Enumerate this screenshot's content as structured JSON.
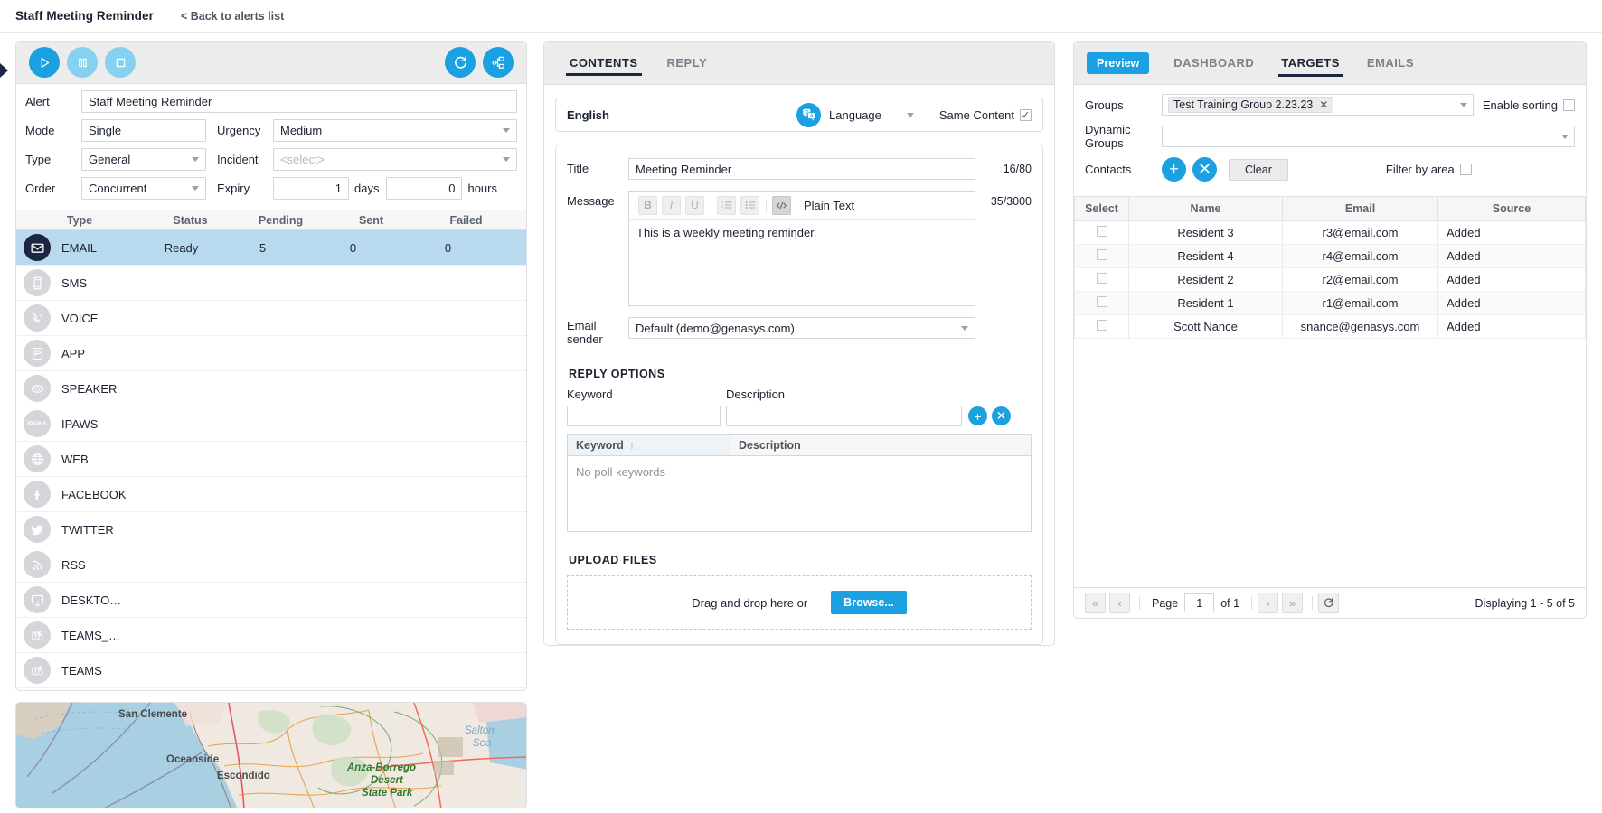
{
  "header": {
    "title": "Staff Meeting Reminder",
    "back_link": "< Back to alerts list"
  },
  "alert_panel": {
    "toolbar": {
      "play_icon": "play-icon",
      "pause_icon": "pause-icon",
      "stop_icon": "stop-icon",
      "refresh_icon": "refresh-icon",
      "workflow_icon": "workflow-icon"
    },
    "fields": {
      "alert_label": "Alert",
      "alert_value": "Staff Meeting Reminder",
      "mode_label": "Mode",
      "mode_value": "Single",
      "urgency_label": "Urgency",
      "urgency_value": "Medium",
      "type_label": "Type",
      "type_value": "General",
      "incident_label": "Incident",
      "incident_placeholder": "<select>",
      "order_label": "Order",
      "order_value": "Concurrent",
      "expiry_label": "Expiry",
      "expiry_days": "1",
      "days_unit": "days",
      "expiry_hours": "0",
      "hours_unit": "hours"
    },
    "channel_headers": [
      "Type",
      "Status",
      "Pending",
      "Sent",
      "Failed"
    ],
    "channels": [
      {
        "icon": "email-icon",
        "name": "EMAIL",
        "status": "Ready",
        "pending": "5",
        "sent": "0",
        "failed": "0",
        "selected": true
      },
      {
        "icon": "sms-icon",
        "name": "SMS",
        "status": "",
        "pending": "",
        "sent": "",
        "failed": "",
        "selected": false
      },
      {
        "icon": "voice-icon",
        "name": "VOICE",
        "status": "",
        "pending": "",
        "sent": "",
        "failed": "",
        "selected": false
      },
      {
        "icon": "app-icon",
        "name": "APP",
        "status": "",
        "pending": "",
        "sent": "",
        "failed": "",
        "selected": false
      },
      {
        "icon": "speaker-icon",
        "name": "SPEAKER",
        "status": "",
        "pending": "",
        "sent": "",
        "failed": "",
        "selected": false
      },
      {
        "icon": "ipaws-icon",
        "name": "IPAWS",
        "status": "",
        "pending": "",
        "sent": "",
        "failed": "",
        "selected": false
      },
      {
        "icon": "web-icon",
        "name": "WEB",
        "status": "",
        "pending": "",
        "sent": "",
        "failed": "",
        "selected": false
      },
      {
        "icon": "facebook-icon",
        "name": "FACEBOOK",
        "status": "",
        "pending": "",
        "sent": "",
        "failed": "",
        "selected": false
      },
      {
        "icon": "twitter-icon",
        "name": "TWITTER",
        "status": "",
        "pending": "",
        "sent": "",
        "failed": "",
        "selected": false
      },
      {
        "icon": "rss-icon",
        "name": "RSS",
        "status": "",
        "pending": "",
        "sent": "",
        "failed": "",
        "selected": false
      },
      {
        "icon": "desktop-icon",
        "name": "DESKTO…",
        "status": "",
        "pending": "",
        "sent": "",
        "failed": "",
        "selected": false
      },
      {
        "icon": "teams-icon",
        "name": "TEAMS_…",
        "status": "",
        "pending": "",
        "sent": "",
        "failed": "",
        "selected": false
      },
      {
        "icon": "teams-icon",
        "name": "TEAMS",
        "status": "",
        "pending": "",
        "sent": "",
        "failed": "",
        "selected": false
      }
    ]
  },
  "map": {
    "labels": [
      {
        "text": "San Clemente",
        "style": "dark"
      },
      {
        "text": "Oceanside",
        "style": "dark"
      },
      {
        "text": "Escondido",
        "style": "dark"
      },
      {
        "text": "Anza-Borrego",
        "style": "green"
      },
      {
        "text": "Desert",
        "style": "green"
      },
      {
        "text": "State Park",
        "style": "green"
      },
      {
        "text": "Salton",
        "style": "blue"
      },
      {
        "text": "Sea",
        "style": "blue"
      }
    ]
  },
  "contents": {
    "tabs": [
      {
        "label": "CONTENTS",
        "active": true
      },
      {
        "label": "REPLY",
        "active": false
      }
    ],
    "language": {
      "name": "English",
      "icon": "translate-icon",
      "button_label": "Language",
      "same_content_label": "Same Content",
      "same_content_checked": true
    },
    "title_label": "Title",
    "title_value": "Meeting Reminder",
    "title_counter": "16/80",
    "message_label": "Message",
    "message_value": "This is a weekly meeting reminder.",
    "message_counter": "35/3000",
    "editor_buttons": [
      "B",
      "I",
      "U",
      "ordered-list-icon",
      "unordered-list-icon",
      "source-code-icon"
    ],
    "plain_text_label": "Plain Text",
    "sender_label": "Email sender",
    "sender_value": "Default (demo@genasys.com)",
    "reply_options": {
      "section_title": "REPLY OPTIONS",
      "keyword_label": "Keyword",
      "description_label": "Description",
      "keyword_value": "",
      "description_value": "",
      "add_icon": "plus-icon",
      "remove_icon": "close-icon",
      "grid_headers": [
        "Keyword",
        "Description"
      ],
      "sort_indicator": "↑",
      "empty_text": "No poll keywords"
    },
    "upload": {
      "section_title": "UPLOAD FILES",
      "drop_text": "Drag and drop here or",
      "browse_label": "Browse..."
    }
  },
  "targets": {
    "tabs": [
      {
        "label": "Preview",
        "active": false,
        "pill": true
      },
      {
        "label": "DASHBOARD",
        "active": false,
        "pill": false
      },
      {
        "label": "TARGETS",
        "active": true,
        "pill": false
      },
      {
        "label": "EMAILS",
        "active": false,
        "pill": false
      }
    ],
    "groups_label": "Groups",
    "groups_chip": "Test Training Group 2.23.23",
    "chip_close_icon": "close-icon",
    "enable_sorting_label": "Enable sorting",
    "enable_sorting_checked": false,
    "dynamic_groups_label": "Dynamic Groups",
    "dynamic_groups_value": "",
    "contacts_label": "Contacts",
    "add_contact_icon": "plus-icon",
    "remove_contact_icon": "close-icon",
    "clear_label": "Clear",
    "filter_by_area_label": "Filter by area",
    "filter_by_area_checked": false,
    "table_headers": [
      "Select",
      "Name",
      "Email",
      "Source"
    ],
    "rows": [
      {
        "name": "Resident 3",
        "email": "r3@email.com",
        "source": "Added"
      },
      {
        "name": "Resident 4",
        "email": "r4@email.com",
        "source": "Added"
      },
      {
        "name": "Resident 2",
        "email": "r2@email.com",
        "source": "Added"
      },
      {
        "name": "Resident 1",
        "email": "r1@email.com",
        "source": "Added"
      },
      {
        "name": "Scott Nance",
        "email": "snance@genasys.com",
        "source": "Added"
      }
    ],
    "pager": {
      "first_icon": "«",
      "prev_icon": "‹",
      "page_label": "Page",
      "page_value": "1",
      "of_label": "of 1",
      "next_icon": "›",
      "last_icon": "»",
      "refresh_icon": "refresh-icon",
      "displaying": "Displaying 1 - 5 of 5"
    }
  },
  "colors": {
    "accent": "#1ba0e1",
    "dark": "#1d2640",
    "selected_row": "#b9d9ef"
  }
}
